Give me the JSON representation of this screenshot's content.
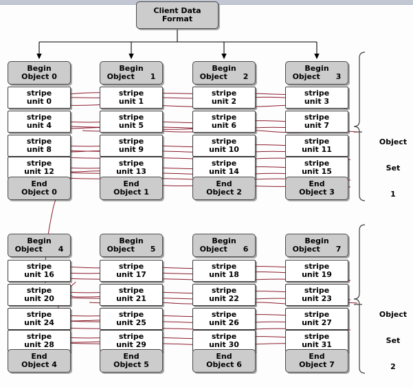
{
  "diagram": {
    "title_box": {
      "label": "Client Data\nFormat"
    },
    "columns": [
      {
        "begin": "Begin\nObject 0",
        "stripes": [
          "stripe\nunit 0",
          "stripe\nunit 4",
          "stripe\nunit 8",
          "stripe\nunit 12"
        ],
        "end": "End\nObject 0"
      },
      {
        "begin": "Begin\nObject      1",
        "stripes": [
          "stripe\nunit 1",
          "stripe\nunit 5",
          "stripe\nunit 9",
          "stripe\nunit 13"
        ],
        "end": "End\nObject 1"
      },
      {
        "begin": "Begin\nObject      2",
        "stripes": [
          "stripe\nunit 2",
          "stripe\nunit 6",
          "stripe\nunit 10",
          "stripe\nunit 14"
        ],
        "end": "End\nObject 2"
      },
      {
        "begin": "Begin\nObject      3",
        "stripes": [
          "stripe\nunit 3",
          "stripe\nunit 7",
          "stripe\nunit 11",
          "stripe\nunit 15"
        ],
        "end": "End\nObject 3"
      },
      {
        "begin": "Begin\nObject      4",
        "stripes": [
          "stripe\nunit 16",
          "stripe\nunit 20",
          "stripe\nunit 24",
          "stripe\nunit 28"
        ],
        "end": "End\nObject 4"
      },
      {
        "begin": "Begin\nObject      5",
        "stripes": [
          "stripe\nunit 17",
          "stripe\nunit 21",
          "stripe\nunit 25",
          "stripe\nunit 29"
        ],
        "end": "End\nObject 5"
      },
      {
        "begin": "Begin\nObject      6",
        "stripes": [
          "stripe\nunit 18",
          "stripe\nunit 22",
          "stripe\nunit 26",
          "stripe\nunit 30"
        ],
        "end": "End\nObject 6"
      },
      {
        "begin": "Begin\nObject      7",
        "stripes": [
          "stripe\nunit 19",
          "stripe\nunit 23",
          "stripe\nunit 27",
          "stripe\nunit 31"
        ],
        "end": "End\nObject 7"
      }
    ],
    "set_labels": [
      {
        "line1": "Object",
        "line2": "Set",
        "line3": "1"
      },
      {
        "line1": "Object",
        "line2": "Set",
        "line3": "2"
      }
    ],
    "colors": {
      "box_fill_gray": "#cccccc",
      "box_fill_white": "#ffffff",
      "border": "#3a3a3a",
      "annotation_red": "#8b1a2b",
      "top_band": "#c3c7d4"
    }
  }
}
